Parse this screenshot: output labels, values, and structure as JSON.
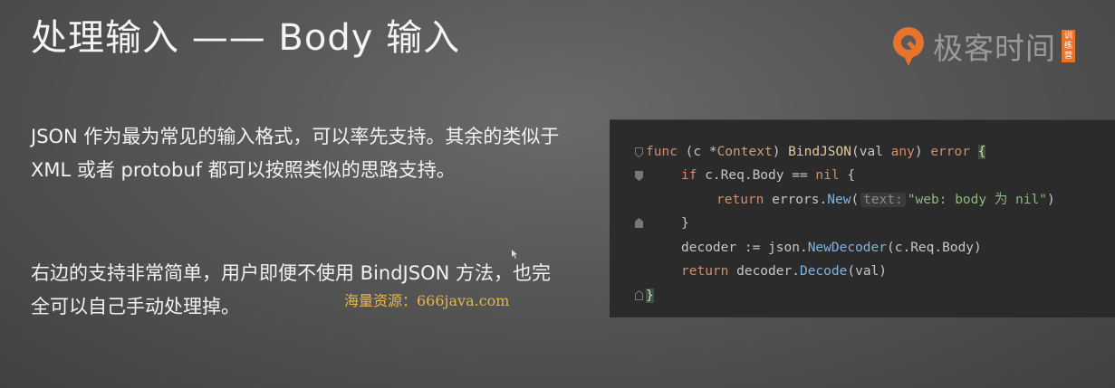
{
  "slide": {
    "title": "处理输入 —— Body 输入",
    "paragraph_1": "JSON 作为最为常见的输入格式，可以率先支持。其余的类似于 XML 或者 protobuf 都可以按照类似的思路支持。",
    "paragraph_2": "右边的支持非常简单，用户即便不使用 BindJSON 方法，也完全可以自己手动处理掉。",
    "watermark": "海量资源：666java.com"
  },
  "logo": {
    "text": "极客时间",
    "badge_lines": [
      "训",
      "练",
      "营"
    ],
    "accent_color": "#e8742c"
  },
  "code": {
    "line1": {
      "kw_func": "func",
      "params_open": " (c *",
      "recv_type": "Context",
      "params_close": ") ",
      "name": "BindJSON",
      "args_open": "(val ",
      "arg_type": "any",
      "args_close": ") ",
      "ret_type": "error",
      "space": " ",
      "brace": "{"
    },
    "line2": {
      "kw_if": "if",
      "expr": " c.Req.Body == ",
      "nil": "nil",
      "tail": " {"
    },
    "line3": {
      "kw_return": "return",
      "pkg": " errors.",
      "call": "New",
      "paren_open": "(",
      "hint": "text:",
      "string": "\"web: body 为 nil\"",
      "paren_close": ")"
    },
    "line4": {
      "text": "}"
    },
    "line5": {
      "lhs": "decoder := json.",
      "call": "NewDecoder",
      "rest": "(c.Req.Body)"
    },
    "line6": {
      "kw_return": "return",
      "pkg": " decoder.",
      "call": "Decode",
      "rest": "(val)"
    },
    "line7": {
      "brace": "}"
    }
  }
}
